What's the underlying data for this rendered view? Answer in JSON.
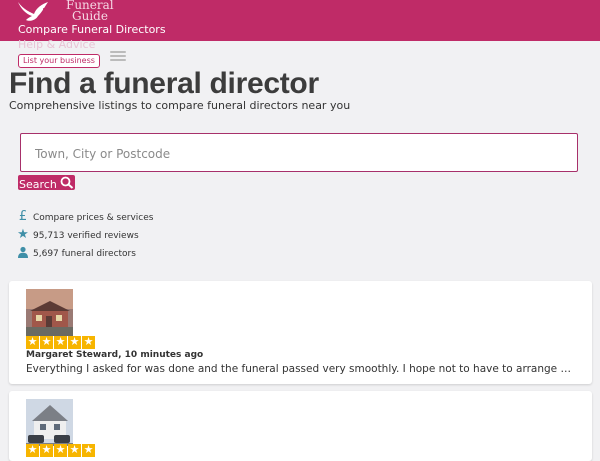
{
  "header": {
    "logo_text_line1": "Funeral",
    "logo_text_line2": "Guide",
    "nav": [
      "Compare Funeral Directors",
      "Help & Advice"
    ],
    "list_business_label": "List your business",
    "brand_color": "#bf2b67"
  },
  "hero": {
    "title": "Find a funeral director",
    "subtitle": "Comprehensive listings to compare funeral directors near you",
    "search": {
      "placeholder": "Town, City or Postcode",
      "value": "",
      "button_label": "Search",
      "button_icon": "search-icon"
    }
  },
  "features": [
    {
      "icon": "pound-icon",
      "label": "Compare prices & services"
    },
    {
      "icon": "star-icon",
      "label": "95,713 verified reviews"
    },
    {
      "icon": "person-icon",
      "label": "5,697 funeral directors"
    }
  ],
  "reviews": [
    {
      "rating": 5,
      "reviewer": "Margaret Steward, 10 minutes ago",
      "text": "Everything I asked for was done and the funeral passed very smoothly. I hope not to have to arrange another funeral for a long time but if I do I will use them again."
    },
    {
      "rating": 5,
      "reviewer": "",
      "text": ""
    }
  ]
}
